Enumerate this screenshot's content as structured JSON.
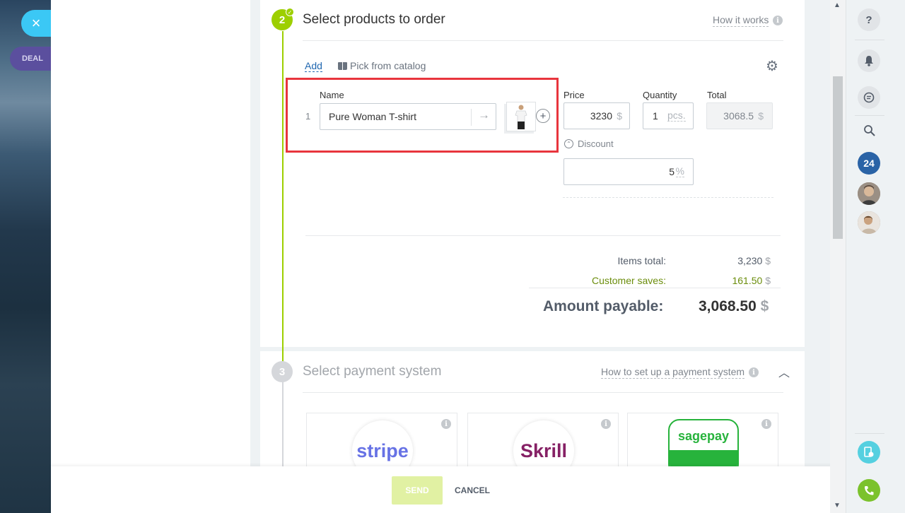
{
  "left": {
    "close_glyph": "×",
    "deal_tag": "DEAL"
  },
  "step2": {
    "number": "2",
    "title": "Select products to order",
    "how_link": "How it works",
    "add_link": "Add",
    "catalog_link": "Pick from catalog",
    "columns": {
      "name": "Name",
      "price": "Price",
      "quantity": "Quantity",
      "total": "Total"
    },
    "row": {
      "index": "1",
      "name": "Pure Woman T-shirt",
      "price": "3230",
      "price_currency": "$",
      "quantity": "1",
      "quantity_unit": "pcs.",
      "total": "3068.5",
      "total_currency": "$",
      "discount_label": "Discount",
      "discount_value": "5",
      "discount_unit": "%"
    },
    "totals": {
      "items_total_label": "Items total:",
      "items_total_value": "3,230",
      "customer_saves_label": "Customer saves:",
      "customer_saves_value": "161.50",
      "currency": "$",
      "amount_payable_label": "Amount payable:",
      "amount_payable_value": "3,068.50"
    }
  },
  "step3": {
    "number": "3",
    "title": "Select payment system",
    "how_link": "How to set up a payment system",
    "providers": [
      "stripe",
      "Skrill",
      "sagepay"
    ]
  },
  "footer": {
    "send": "SEND",
    "cancel": "CANCEL"
  },
  "rightbar": {
    "help_glyph": "?",
    "badge_24": "24"
  },
  "colors": {
    "accent_green": "#9dcf00",
    "link_blue": "#2067b0",
    "highlight_red": "#e8353d",
    "close_blue": "#3bc8f5",
    "deal_purple": "#5b4f9e"
  }
}
